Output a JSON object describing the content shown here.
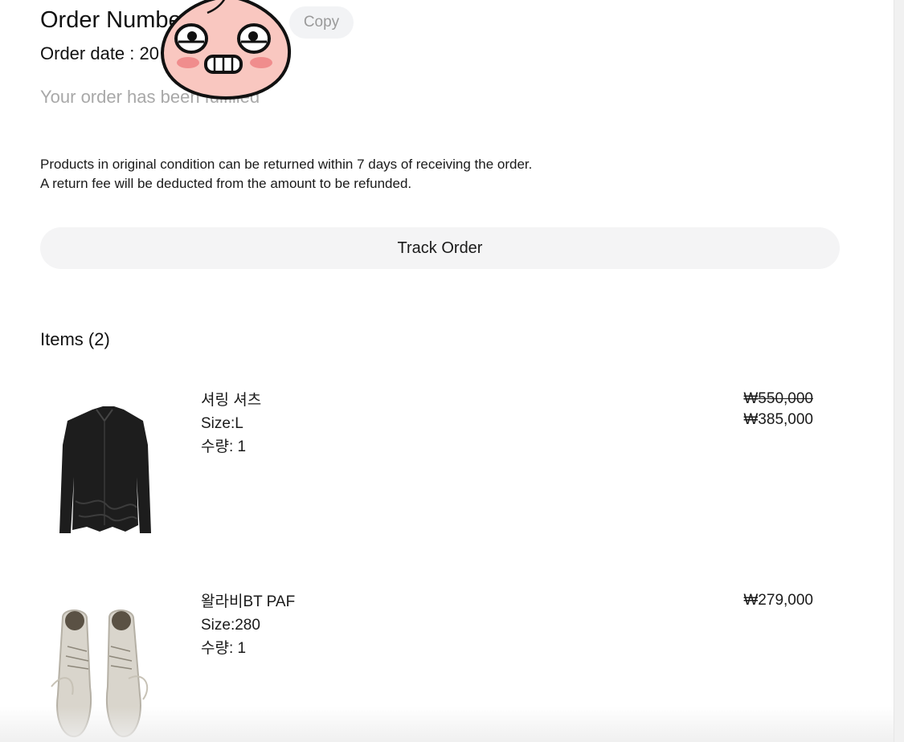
{
  "order": {
    "number_label": "Order Number",
    "copy_label": "Copy",
    "date_label": "Order date : 20",
    "status": "Your order has been fulfilled"
  },
  "policy": {
    "line1": "Products in original condition can be returned within 7 days of receiving the order.",
    "line2": "A return fee will be deducted from the amount to be refunded."
  },
  "track_label": "Track Order",
  "items_heading": "Items (2)",
  "items": [
    {
      "name": "셔링 셔츠",
      "size": "Size:L",
      "qty": "수량: 1",
      "original_price": "₩550,000",
      "price": "₩385,000",
      "image_icon": "black-shirt-icon"
    },
    {
      "name": "왈라비BT PAF",
      "size": "Size:280",
      "qty": "수량: 1",
      "price": "₩279,000",
      "image_icon": "suede-boots-icon"
    }
  ],
  "colors": {
    "copy_button_bg": "#f2f3f5",
    "track_button_bg": "#f4f4f5",
    "status_text": "#a8a8a8",
    "avatar_skin": "#f9c7c0",
    "avatar_cheeks": "#f08d8d"
  }
}
